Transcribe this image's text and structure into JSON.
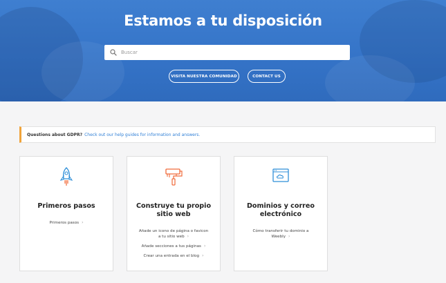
{
  "hero": {
    "title": "Estamos a tu disposición",
    "search": {
      "placeholder": "Buscar",
      "value": ""
    },
    "buttons": {
      "community": "VISITA NUESTRA COMUNIDAD",
      "contact": "CONTACT US"
    }
  },
  "notice": {
    "question": "Questions about GDPR?",
    "link": "Check out our help guides for information and answers.",
    "accent": "#f0a33a",
    "link_color": "#2f7fd6"
  },
  "cards": [
    {
      "icon": "rocket-icon",
      "title": "Primeros pasos",
      "links": [
        "Primeros pasos"
      ]
    },
    {
      "icon": "paint-roller-icon",
      "title_lines": [
        "Construye tu propio",
        "sitio web"
      ],
      "links": [
        [
          "Añade un icono de página o favicon",
          "a tu sitio web"
        ],
        "Añade secciones a tus páginas",
        "Crear una entrada en el blog"
      ]
    },
    {
      "icon": "browser-cloud-icon",
      "title_lines": [
        "Dominios y correo",
        "electrónico"
      ],
      "links": [
        [
          "Cómo transferir tu dominio a",
          "Weebly"
        ]
      ]
    }
  ],
  "chevron": "›",
  "colors": {
    "hero_blue": "#3574c8",
    "icon_blue": "#2f8fd8",
    "icon_orange": "#f06a3a"
  }
}
